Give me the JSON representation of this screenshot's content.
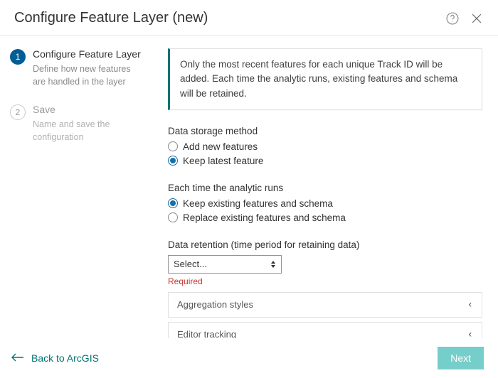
{
  "header": {
    "title": "Configure Feature Layer (new)"
  },
  "sidebar": {
    "steps": [
      {
        "num": "1",
        "title": "Configure Feature Layer",
        "desc": "Define how new features are handled in the layer"
      },
      {
        "num": "2",
        "title": "Save",
        "desc": "Name and save the configuration"
      }
    ]
  },
  "main": {
    "callout": "Only the most recent features for each unique Track ID will be added. Each time the analytic runs, existing features and schema will be retained.",
    "storage": {
      "label": "Data storage method",
      "opt_add": "Add new features",
      "opt_keep": "Keep latest feature"
    },
    "runs": {
      "label": "Each time the analytic runs",
      "opt_keep": "Keep existing features and schema",
      "opt_replace": "Replace existing features and schema"
    },
    "retention": {
      "label": "Data retention (time period for retaining data)",
      "placeholder": "Select...",
      "required": "Required"
    },
    "acc1": "Aggregation styles",
    "acc2": "Editor tracking"
  },
  "footer": {
    "back": "Back to ArcGIS",
    "next": "Next"
  }
}
